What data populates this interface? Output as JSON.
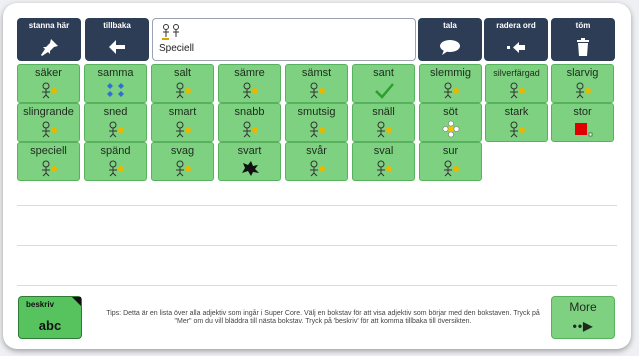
{
  "toolbar": {
    "pin": {
      "label": "stanna här",
      "icon": "pin-icon"
    },
    "back": {
      "label": "tillbaka",
      "icon": "arrow-left-icon"
    },
    "speak": {
      "label": "tala",
      "icon": "speech-bubble-icon"
    },
    "delete_word": {
      "label": "radera ord",
      "icon": "backspace-icon"
    },
    "clear": {
      "label": "töm",
      "icon": "trash-icon"
    }
  },
  "message": {
    "text": "Speciell",
    "icon": "two-people-symbol-icon"
  },
  "words": [
    {
      "label": "säker",
      "icon": "safe-symbol-icon"
    },
    {
      "label": "samma",
      "icon": "same-symbol-icon"
    },
    {
      "label": "salt",
      "icon": "salt-symbol-icon"
    },
    {
      "label": "sämre",
      "icon": "worse-symbol-icon"
    },
    {
      "label": "sämst",
      "icon": "worst-symbol-icon"
    },
    {
      "label": "sant",
      "icon": "checkmark-icon"
    },
    {
      "label": "slemmig",
      "icon": "slimy-symbol-icon"
    },
    {
      "label": "silverfärgad",
      "icon": "silver-symbol-icon"
    },
    {
      "label": "slarvig",
      "icon": "sloppy-symbol-icon"
    },
    {
      "label": "slingrande",
      "icon": "winding-symbol-icon"
    },
    {
      "label": "sned",
      "icon": "crooked-symbol-icon"
    },
    {
      "label": "smart",
      "icon": "smart-symbol-icon"
    },
    {
      "label": "snabb",
      "icon": "fast-symbol-icon"
    },
    {
      "label": "smutsig",
      "icon": "dirty-symbol-icon"
    },
    {
      "label": "snäll",
      "icon": "kind-symbol-icon"
    },
    {
      "label": "söt",
      "icon": "flower-icon"
    },
    {
      "label": "stark",
      "icon": "strong-symbol-icon"
    },
    {
      "label": "stor",
      "icon": "big-square-icon"
    },
    {
      "label": "speciell",
      "icon": "two-people-symbol-icon"
    },
    {
      "label": "spänd",
      "icon": "tense-symbol-icon"
    },
    {
      "label": "svag",
      "icon": "weak-symbol-icon"
    },
    {
      "label": "svart",
      "icon": "black-blob-icon"
    },
    {
      "label": "svår",
      "icon": "difficult-symbol-icon"
    },
    {
      "label": "sval",
      "icon": "cool-symbol-icon"
    },
    {
      "label": "sur",
      "icon": "sour-symbol-icon"
    }
  ],
  "abc_button": {
    "label": "beskriv",
    "big": "abc"
  },
  "tips": "Tips: Detta är en lista över alla adjektiv som ingår i Super Core. Välj en bokstav för att visa adjektiv som börjar med den bokstaven. Tryck på \"Mer\" om du vill bläddra till nästa bokstav. Tryck på 'beskriv' för att komma tillbaka till översikten.",
  "more_button": {
    "label": "More",
    "icon": "dots-arrow-icon"
  },
  "colors": {
    "toolbar": "#2e3d56",
    "word_cell": "#7ed180",
    "abc_button": "#57c35f"
  }
}
